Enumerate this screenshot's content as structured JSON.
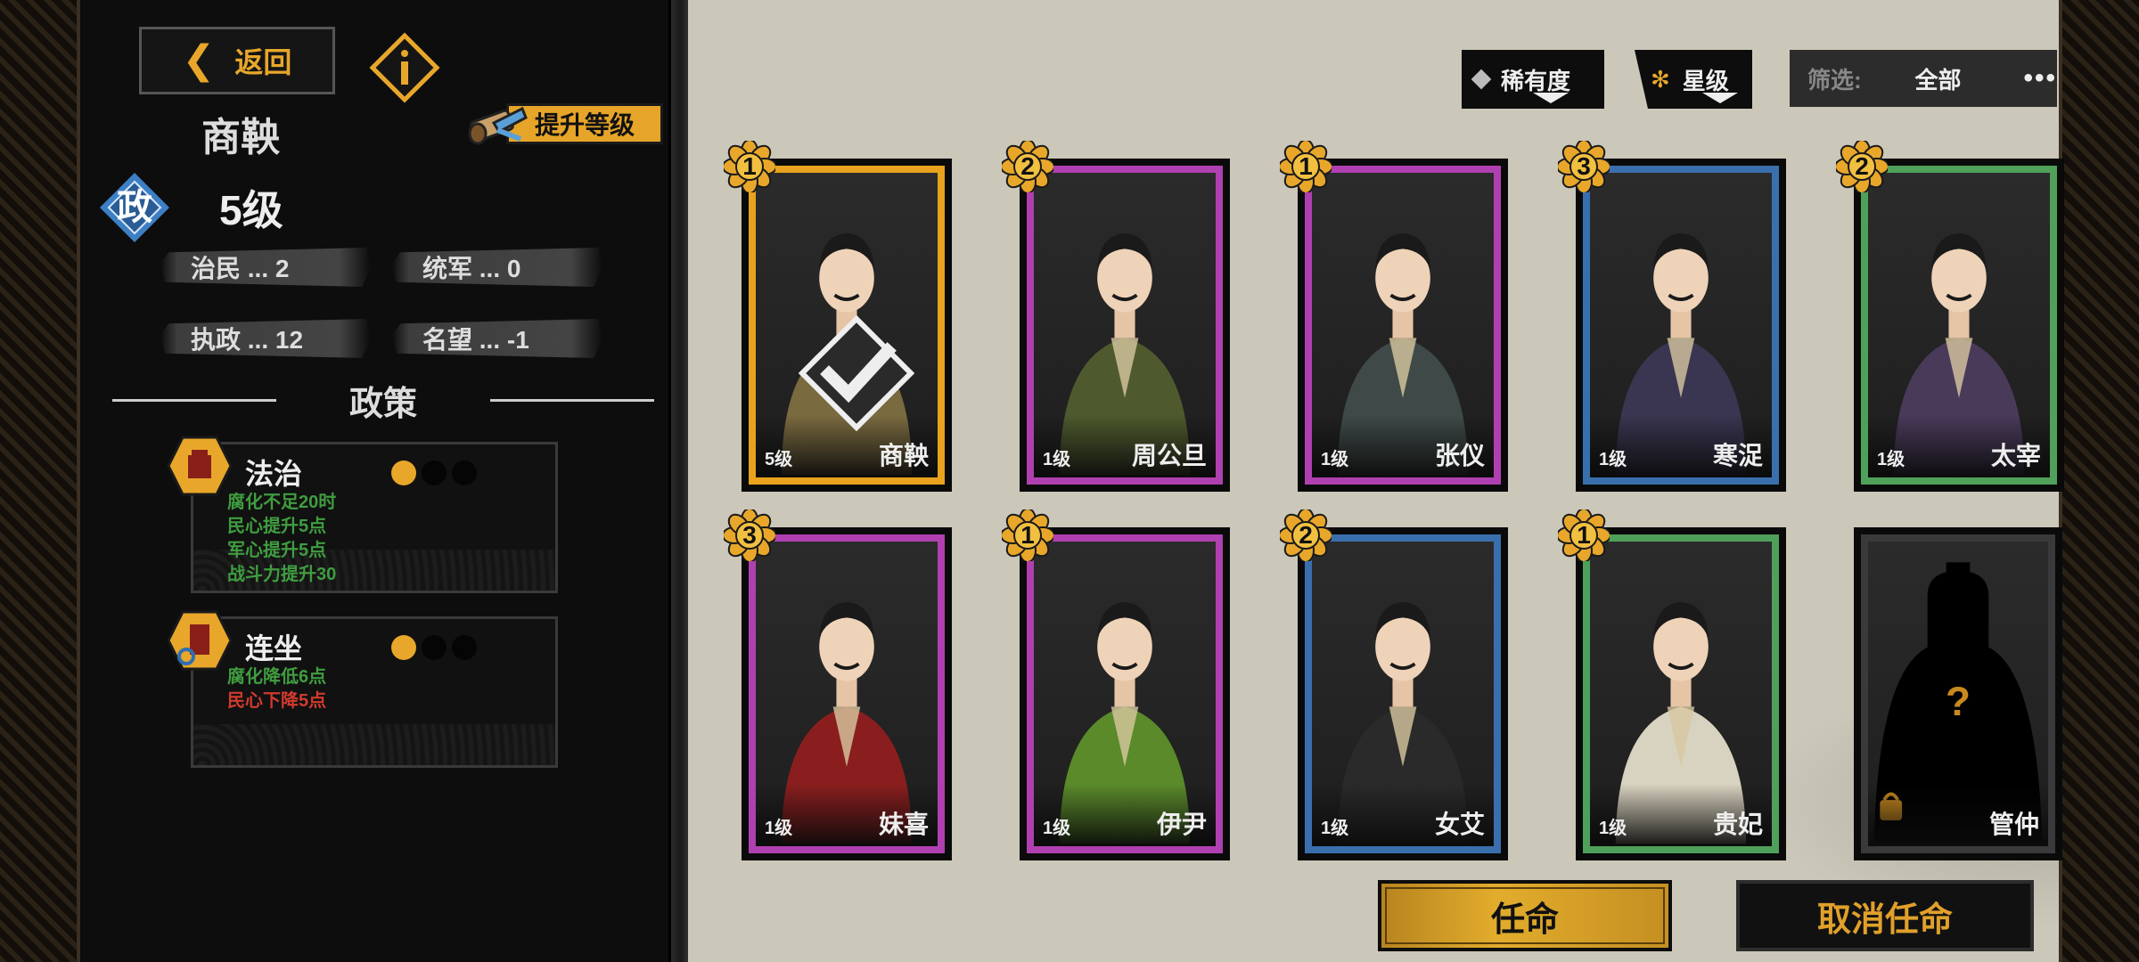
{
  "header": {
    "back_label": "返回",
    "upgrade_label": "提升等级"
  },
  "hero": {
    "name": "商鞅",
    "office_badge": "政",
    "level": "5级",
    "stats": [
      {
        "label": "治民 ... 2"
      },
      {
        "label": "统军 ... 0"
      },
      {
        "label": "执政 ... 12"
      },
      {
        "label": "名望 ... -1"
      }
    ]
  },
  "policies": {
    "title": "政策",
    "items": [
      {
        "name": "法治",
        "level_filled": 1,
        "level_max": 3,
        "effects": [
          {
            "text": "腐化不足20时",
            "tone": "good"
          },
          {
            "text": "民心提升5点",
            "tone": "good"
          },
          {
            "text": "军心提升5点",
            "tone": "good"
          },
          {
            "text": "战斗力提升30",
            "tone": "good"
          }
        ]
      },
      {
        "name": "连坐",
        "level_filled": 1,
        "level_max": 3,
        "effects": [
          {
            "text": "腐化降低6点",
            "tone": "good"
          },
          {
            "text": "民心下降5点",
            "tone": "bad"
          }
        ]
      }
    ]
  },
  "sort": {
    "rarity_label": "稀有度",
    "star_label": "星级"
  },
  "filter": {
    "label": "筛选:",
    "value": "全部",
    "more": "•••"
  },
  "colors": {
    "accent": "#e8a72a",
    "rarity_orange": "#e8a21e",
    "rarity_purple": "#b040b0",
    "rarity_blue": "#3a6fae",
    "rarity_green": "#4fa05a",
    "rarity_gray": "#3a3a3a"
  },
  "cards": [
    {
      "name": "商鞅",
      "level": "5级",
      "stars": "1",
      "rarity": "orange",
      "selected": true
    },
    {
      "name": "周公旦",
      "level": "1级",
      "stars": "2",
      "rarity": "purple",
      "selected": false
    },
    {
      "name": "张仪",
      "level": "1级",
      "stars": "1",
      "rarity": "purple",
      "selected": false
    },
    {
      "name": "寒浞",
      "level": "1级",
      "stars": "3",
      "rarity": "blue",
      "selected": false
    },
    {
      "name": "太宰",
      "level": "1级",
      "stars": "2",
      "rarity": "green",
      "selected": false
    },
    {
      "name": "妹喜",
      "level": "1级",
      "stars": "3",
      "rarity": "purple",
      "selected": false
    },
    {
      "name": "伊尹",
      "level": "1级",
      "stars": "1",
      "rarity": "purple",
      "selected": false
    },
    {
      "name": "女艾",
      "level": "1级",
      "stars": "2",
      "rarity": "blue",
      "selected": false
    },
    {
      "name": "贵妃",
      "level": "1级",
      "stars": "1",
      "rarity": "green",
      "selected": false
    },
    {
      "name": "管仲",
      "level": "",
      "stars": "",
      "rarity": "gray",
      "selected": false,
      "locked": true
    }
  ],
  "actions": {
    "appoint_label": "任命",
    "cancel_label": "取消任命"
  }
}
